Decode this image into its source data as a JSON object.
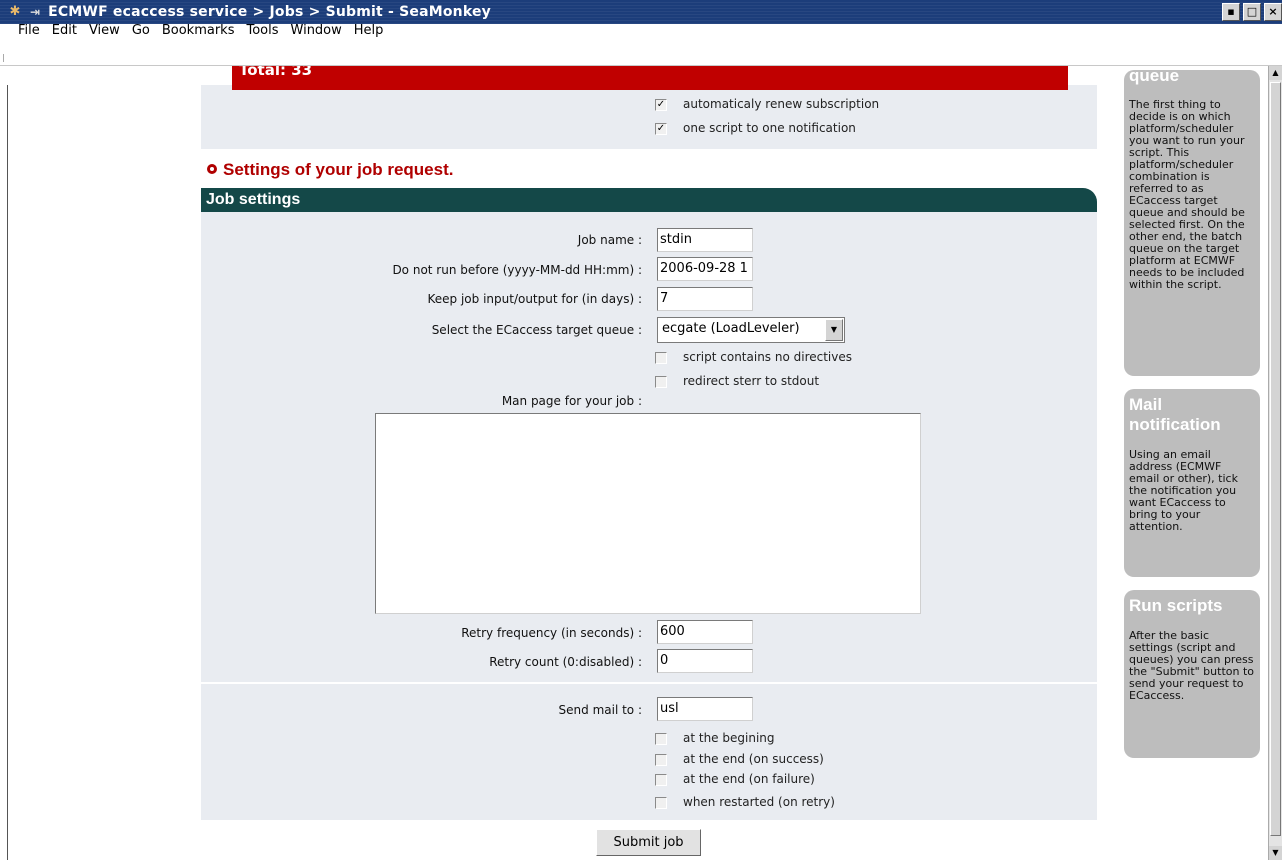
{
  "window": {
    "title": "ECMWF ecaccess service > Jobs > Submit - SeaMonkey",
    "buttons": [
      "▪",
      "□",
      "×"
    ]
  },
  "menubar": {
    "items": [
      "File",
      "Edit",
      "View",
      "Go",
      "Bookmarks",
      "Tools",
      "Window",
      "Help"
    ]
  },
  "top_section": {
    "total_label": "Total: 33",
    "auto_renew": {
      "label": "automaticaly renew subscription",
      "checked": true
    },
    "one_script": {
      "label": "one script to one notification",
      "checked": true
    }
  },
  "section_heading": "Settings of your job request.",
  "job_settings": {
    "header": "Job settings",
    "job_name": {
      "label": "Job name :",
      "value": "stdin"
    },
    "not_before": {
      "label": "Do not run before (yyyy-MM-dd HH:mm) :",
      "value": "2006-09-28 1"
    },
    "keep_io": {
      "label": "Keep job input/output for (in days) :",
      "value": "7"
    },
    "target_queue": {
      "label": "Select the ECaccess target queue :",
      "value": "ecgate (LoadLeveler)"
    },
    "no_directives": {
      "label": "script contains no directives",
      "checked": false
    },
    "redirect": {
      "label": "redirect sterr to stdout",
      "checked": false
    },
    "man_page_label": "Man page for your job :",
    "man_page_value": "",
    "retry_freq": {
      "label": "Retry frequency (in seconds) :",
      "value": "600"
    },
    "retry_count": {
      "label": "Retry count (0:disabled) :",
      "value": "0"
    }
  },
  "mail": {
    "send_to": {
      "label": "Send mail to :",
      "value": "usl"
    },
    "options": [
      {
        "label": "at the begining",
        "checked": false
      },
      {
        "label": "at the end (on success)",
        "checked": false
      },
      {
        "label": "at the end (on failure)",
        "checked": false
      },
      {
        "label": "when restarted (on retry)",
        "checked": false
      }
    ]
  },
  "submit_label": "Submit job",
  "sidebar": {
    "queue": {
      "title": "queue",
      "text": "The first thing to decide is on which platform/scheduler you want to run your script. This platform/scheduler combination is referred to as ECaccess target queue and should be selected first. On the other end, the batch queue on the target platform at ECMWF needs to be included within the script."
    },
    "mail": {
      "title": "Mail notification",
      "text": "Using an email address (ECMWF email or other), tick the notification you want ECaccess to bring to your attention."
    },
    "run": {
      "title": "Run scripts",
      "text": "After the basic settings (script and queues) you can press the \"Submit\" button to send your request to ECaccess."
    }
  }
}
